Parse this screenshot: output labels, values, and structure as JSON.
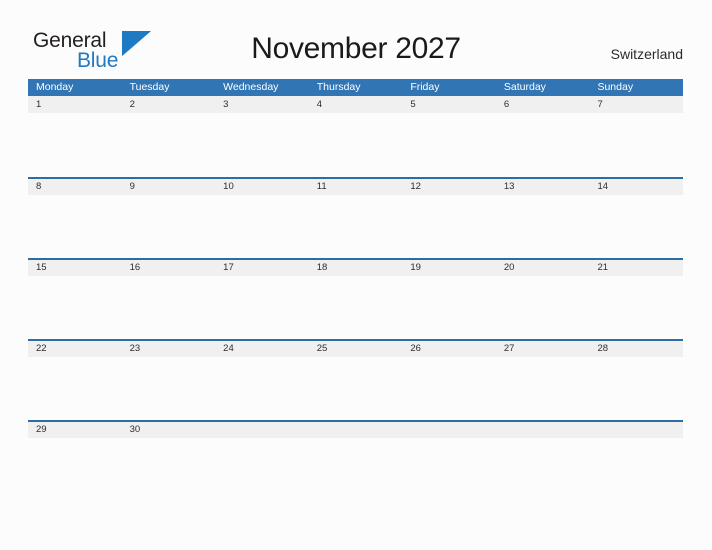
{
  "brand": {
    "name_part1": "General",
    "name_part2": "Blue",
    "triangle_color": "#1f7ac4",
    "text_color_primary": "#231f20",
    "text_color_secondary": "#1f7ac4"
  },
  "header": {
    "title": "November 2027",
    "region": "Switzerland"
  },
  "theme": {
    "header_blue": "#3275b4",
    "row_divider_blue": "#2e6da4",
    "date_band_gray": "#f0f0f0",
    "page_background": "#fcfcfc"
  },
  "calendar": {
    "month": "November",
    "year": "2027",
    "weekday_headers": [
      "Monday",
      "Tuesday",
      "Wednesday",
      "Thursday",
      "Friday",
      "Saturday",
      "Sunday"
    ],
    "weeks": [
      {
        "days": [
          {
            "date": "1",
            "events": ""
          },
          {
            "date": "2",
            "events": ""
          },
          {
            "date": "3",
            "events": ""
          },
          {
            "date": "4",
            "events": ""
          },
          {
            "date": "5",
            "events": ""
          },
          {
            "date": "6",
            "events": ""
          },
          {
            "date": "7",
            "events": ""
          }
        ]
      },
      {
        "days": [
          {
            "date": "8",
            "events": ""
          },
          {
            "date": "9",
            "events": ""
          },
          {
            "date": "10",
            "events": ""
          },
          {
            "date": "11",
            "events": ""
          },
          {
            "date": "12",
            "events": ""
          },
          {
            "date": "13",
            "events": ""
          },
          {
            "date": "14",
            "events": ""
          }
        ]
      },
      {
        "days": [
          {
            "date": "15",
            "events": ""
          },
          {
            "date": "16",
            "events": ""
          },
          {
            "date": "17",
            "events": ""
          },
          {
            "date": "18",
            "events": ""
          },
          {
            "date": "19",
            "events": ""
          },
          {
            "date": "20",
            "events": ""
          },
          {
            "date": "21",
            "events": ""
          }
        ]
      },
      {
        "days": [
          {
            "date": "22",
            "events": ""
          },
          {
            "date": "23",
            "events": ""
          },
          {
            "date": "24",
            "events": ""
          },
          {
            "date": "25",
            "events": ""
          },
          {
            "date": "26",
            "events": ""
          },
          {
            "date": "27",
            "events": ""
          },
          {
            "date": "28",
            "events": ""
          }
        ]
      },
      {
        "days": [
          {
            "date": "29",
            "events": ""
          },
          {
            "date": "30",
            "events": ""
          },
          {
            "date": "",
            "events": ""
          },
          {
            "date": "",
            "events": ""
          },
          {
            "date": "",
            "events": ""
          },
          {
            "date": "",
            "events": ""
          },
          {
            "date": "",
            "events": ""
          }
        ]
      }
    ]
  }
}
